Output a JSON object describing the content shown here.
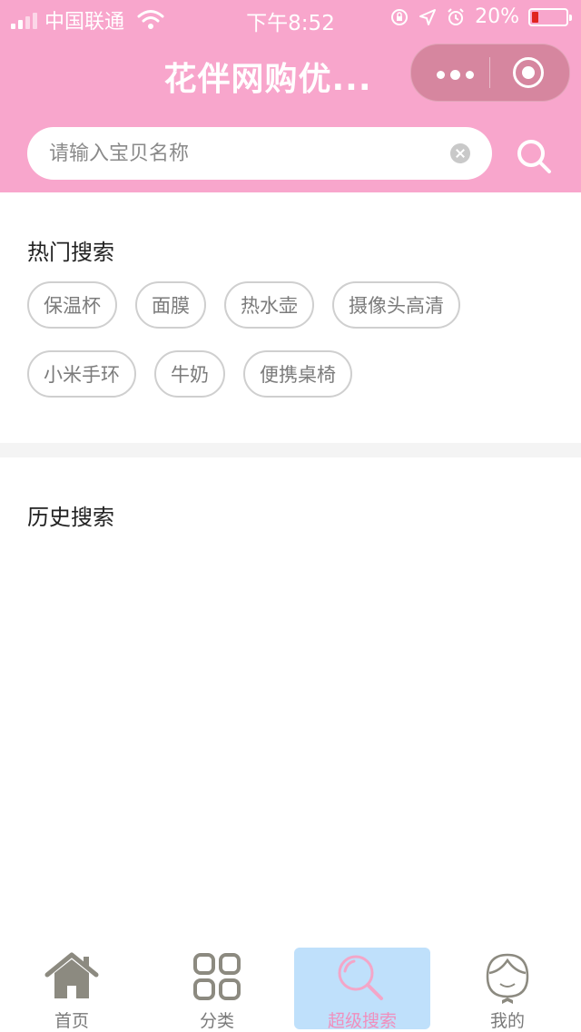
{
  "status_bar": {
    "carrier": "中国联通",
    "time": "下午8:52",
    "battery_percent": "20%",
    "battery_level": 0.2,
    "icons": [
      "signal-icon",
      "wifi-icon",
      "rotation-lock-icon",
      "location-icon",
      "alarm-icon",
      "battery-icon"
    ]
  },
  "nav": {
    "title": "花伴网购优...",
    "menu_icon": "more-dots-icon",
    "close_icon": "target-circle-icon"
  },
  "search": {
    "placeholder": "请输入宝贝名称",
    "value": ""
  },
  "hot_search": {
    "title": "热门搜索",
    "tags": [
      "保温杯",
      "面膜",
      "热水壶",
      "摄像头高清",
      "小米手环",
      "牛奶",
      "便携桌椅"
    ]
  },
  "history_search": {
    "title": "历史搜索",
    "items": []
  },
  "tabbar": {
    "tabs": [
      {
        "label": "首页",
        "icon": "home-icon",
        "active": false
      },
      {
        "label": "分类",
        "icon": "category-grid-icon",
        "active": false
      },
      {
        "label": "超级搜索",
        "icon": "search-icon",
        "active": true
      },
      {
        "label": "我的",
        "icon": "profile-avatar-icon",
        "active": false
      }
    ]
  },
  "colors": {
    "brand_pink": "#f8a6cc",
    "capsule": "#d6869f",
    "active_tab_bg": "#bfe0fb",
    "active_tab_text": "#f08fbd",
    "battery_low": "#e0231f"
  }
}
